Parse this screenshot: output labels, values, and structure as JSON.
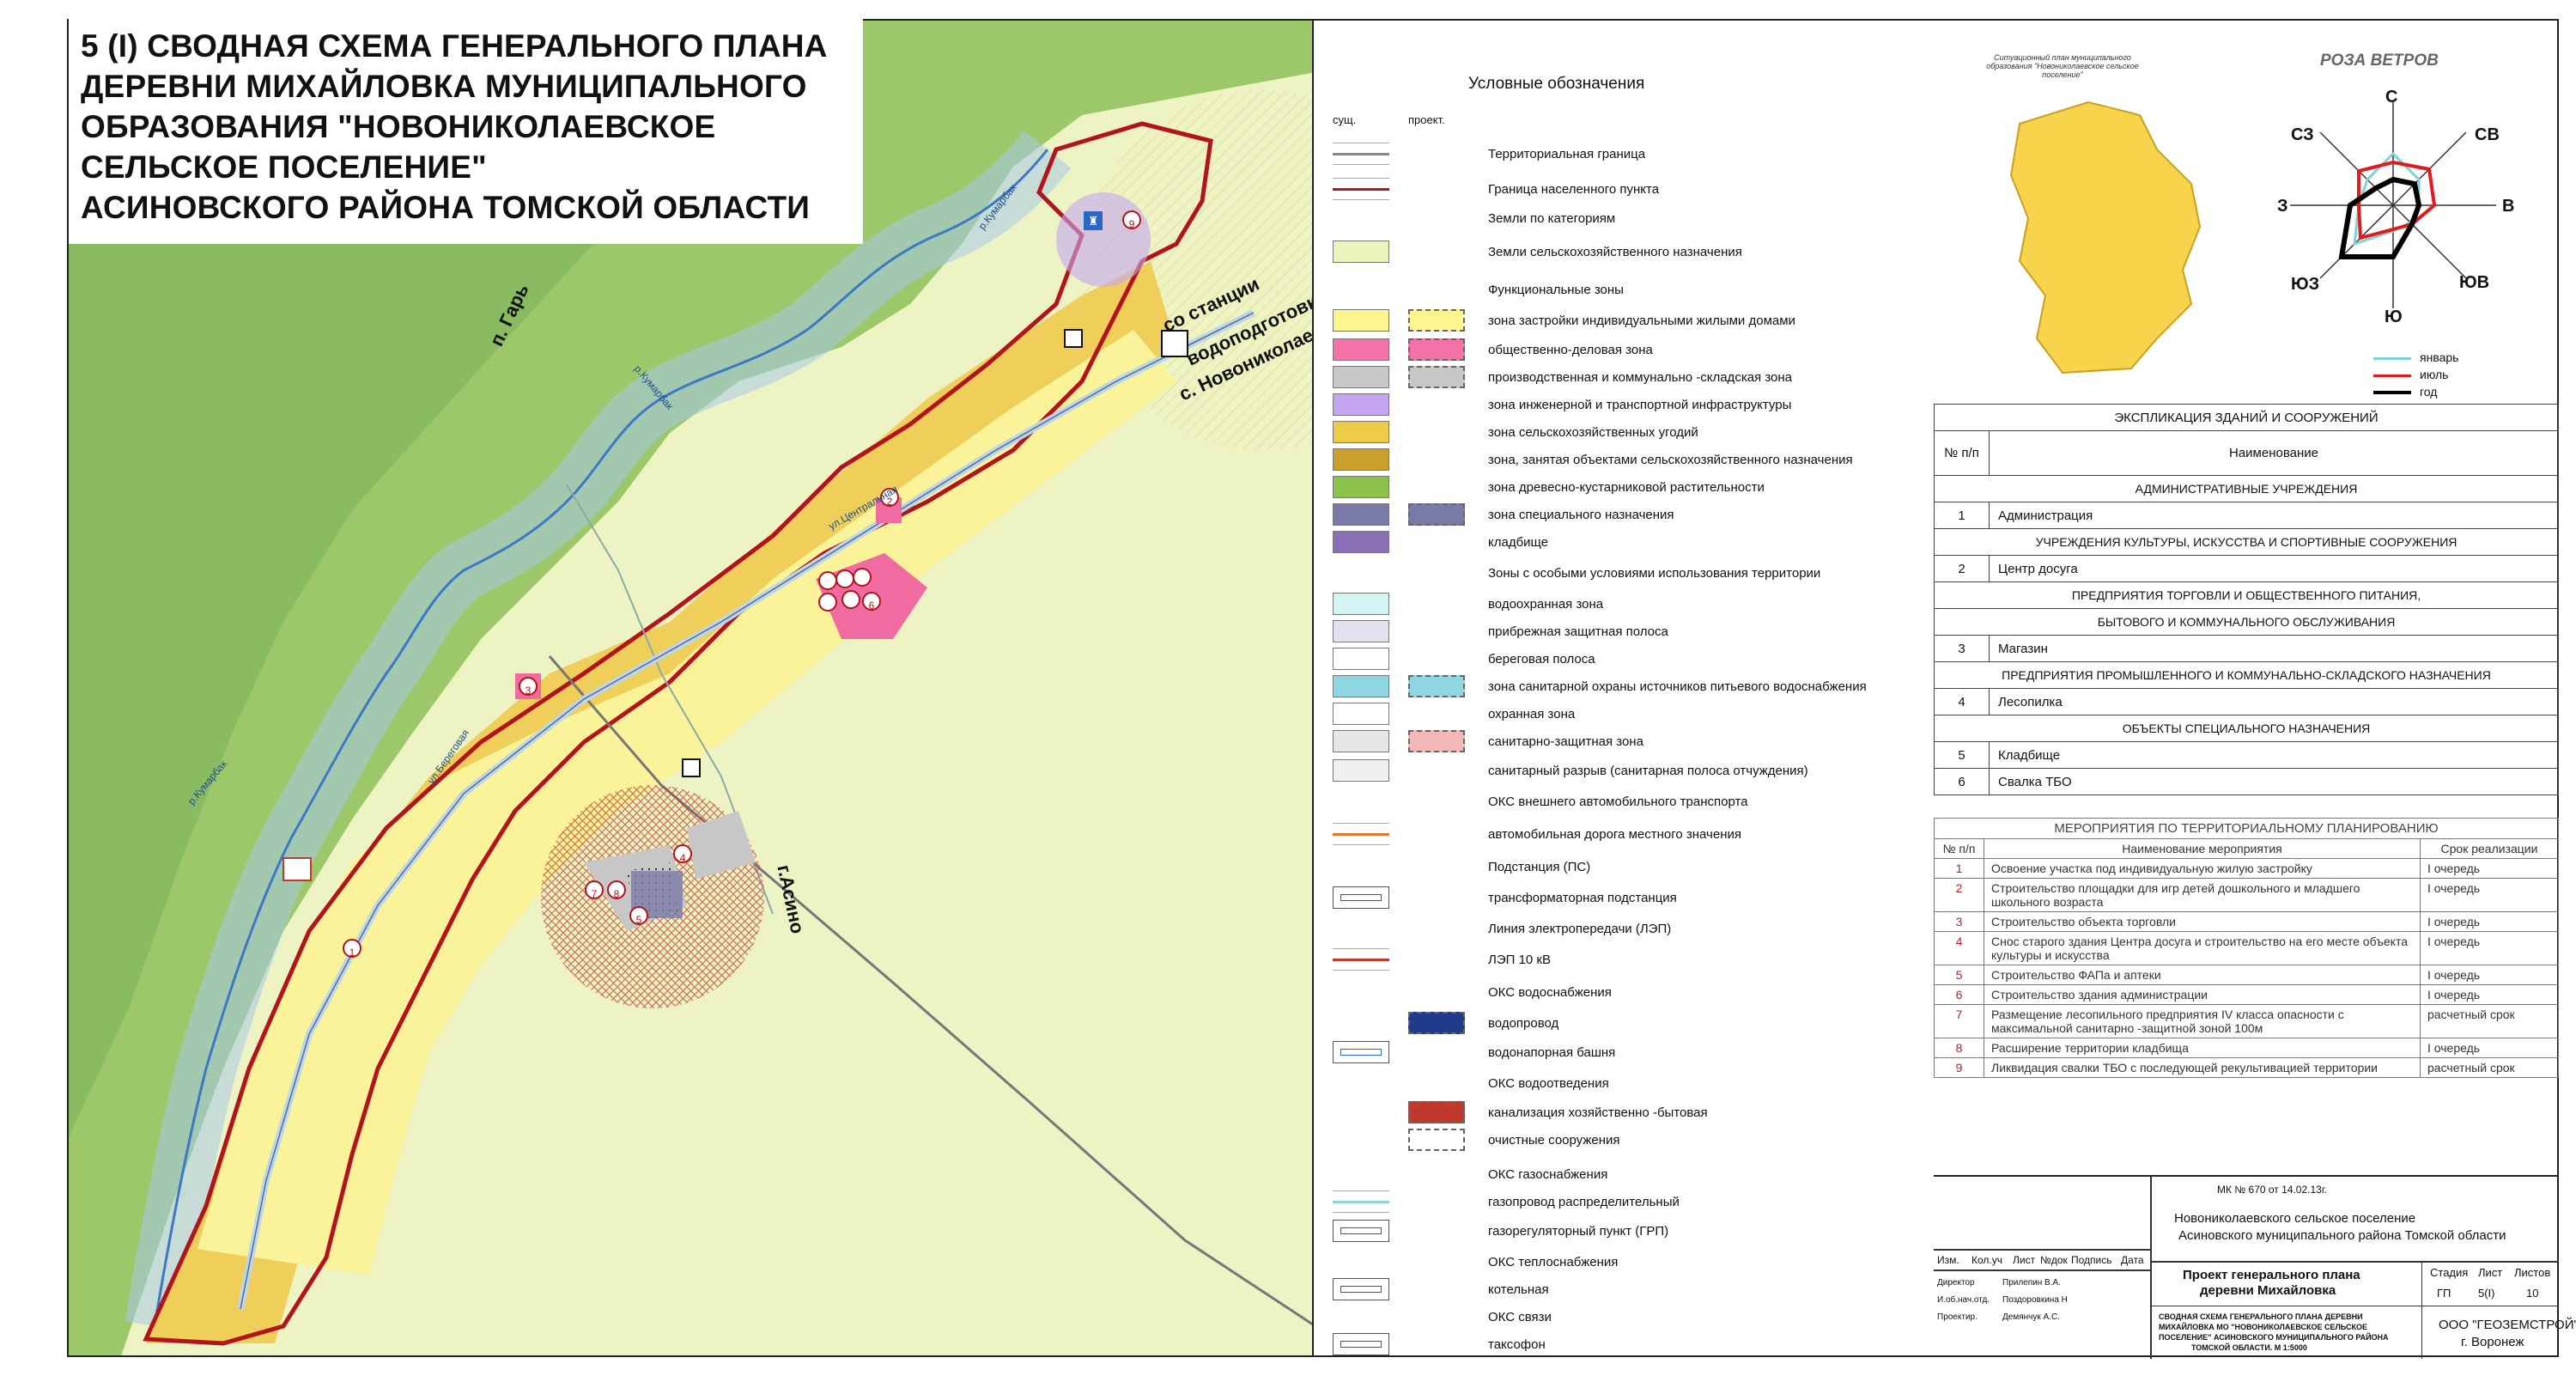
{
  "map": {
    "title_lines": [
      "5 (I) СВОДНАЯ СХЕМА ГЕНЕРАЛЬНОГО ПЛАНА",
      "ДЕРЕВНИ МИХАЙЛОВКА МУНИЦИПАЛЬНОГО",
      "ОБРАЗОВАНИЯ \"НОВОНИКОЛАЕВСКОЕ",
      "СЕЛЬСКОЕ ПОСЕЛЕНИЕ\"",
      "АСИНОВСКОГО РАЙОНА ТОМСКОЙ ОБЛАСТИ"
    ],
    "labels": {
      "river_1": "р.Кумарбак",
      "river_2": "р.Кумарбак",
      "river_3": "р.Кумарбак",
      "street_1": "ул.Береговая",
      "street_2": "ул.Центральная",
      "road_gar": "п. Гарь",
      "road_station_1": "со станции",
      "road_station_2": "водоподготовки",
      "road_novonik": "с. Новониколаевка",
      "road_asino": "г.Асино"
    },
    "markers": [
      "1",
      "2",
      "3",
      "4",
      "5",
      "6",
      "7",
      "8",
      "9"
    ]
  },
  "legend": {
    "title": "Условные обозначения",
    "col_existing": "сущ.",
    "col_project": "проект.",
    "items": [
      {
        "label": "Территориальная граница"
      },
      {
        "label": "Граница населенного пункта"
      },
      {
        "label": "Земли по категориям"
      },
      {
        "label": "Земли сельскохозяйственного назначения"
      },
      {
        "label": "Функциональные зоны"
      },
      {
        "label": "зона застройки индивидуальными жилыми домами"
      },
      {
        "label": "общественно-деловая зона"
      },
      {
        "label": "производственная и коммунально -складская зона"
      },
      {
        "label": "зона инженерной и транспортной инфраструктуры"
      },
      {
        "label": "зона сельскохозяйственных угодий"
      },
      {
        "label": "зона, занятая объектами сельскохозяйственного назначения"
      },
      {
        "label": "зона древесно-кустарниковой растительности"
      },
      {
        "label": "зона специального назначения"
      },
      {
        "label": "кладбище"
      },
      {
        "label": "Зоны с особыми условиями использования территории"
      },
      {
        "label": "водоохранная зона"
      },
      {
        "label": "прибрежная защитная полоса"
      },
      {
        "label": "береговая полоса"
      },
      {
        "label": "зона санитарной охраны источников питьевого водоснабжения"
      },
      {
        "label": "охранная зона"
      },
      {
        "label": "санитарно-защитная зона"
      },
      {
        "label": "санитарный разрыв (санитарная полоса отчуждения)"
      },
      {
        "label": "ОКС внешнего автомобильного транспорта"
      },
      {
        "label": "автомобильная дорога местного значения"
      },
      {
        "label": "Подстанция (ПС)"
      },
      {
        "label": "трансформаторная подстанция"
      },
      {
        "label": "Линия электропередачи (ЛЭП)"
      },
      {
        "label": "ЛЭП 10 кВ"
      },
      {
        "label": "ОКС водоснабжения"
      },
      {
        "label": "водопровод"
      },
      {
        "label": "водонапорная башня"
      },
      {
        "label": "ОКС водоотведения"
      },
      {
        "label": "канализация хозяйственно -бытовая"
      },
      {
        "label": "очистные сооружения"
      },
      {
        "label": "ОКС газоснабжения"
      },
      {
        "label": "газопровод распределительный"
      },
      {
        "label": "газорегуляторный пункт (ГРП)"
      },
      {
        "label": "ОКС теплоснабжения"
      },
      {
        "label": "котельная"
      },
      {
        "label": "ОКС связи"
      },
      {
        "label": "таксофон"
      }
    ],
    "colors": {
      "residential": "#fef58f",
      "public": "#f472a6",
      "industrial": "#c7c7c7",
      "infrastructure": "#c4a6f0",
      "agri_lands": "#eecb47",
      "agri_objects": "#c9a02b",
      "forest": "#8bc34a",
      "special": "#7a7aa8",
      "boundary": "#b3141b"
    }
  },
  "situation": {
    "caption": "Ситуационный план муниципального образования \"Новониколаевское сельское поселение\""
  },
  "wind_rose": {
    "title": "РОЗА ВЕТРОВ",
    "directions": {
      "n": "С",
      "ne": "СВ",
      "e": "В",
      "se": "ЮВ",
      "s": "Ю",
      "sw": "ЮЗ",
      "w": "З",
      "nw": "СЗ"
    },
    "legend": [
      {
        "label": "январь",
        "color": "#7fd3d3"
      },
      {
        "label": "июль",
        "color": "#e11b1b"
      },
      {
        "label": "год",
        "color": "#000000"
      }
    ]
  },
  "explication": {
    "title": "ЭКСПЛИКАЦИЯ ЗДАНИЙ И СООРУЖЕНИЙ",
    "col_num": "№ п/п",
    "col_name": "Наименование",
    "rows": [
      {
        "section": "АДМИНИСТРАТИВНЫЕ УЧРЕЖДЕНИЯ"
      },
      {
        "num": "1",
        "name": "Администрация"
      },
      {
        "section": "УЧРЕЖДЕНИЯ КУЛЬТУРЫ, ИСКУССТВА И СПОРТИВНЫЕ СООРУЖЕНИЯ"
      },
      {
        "num": "2",
        "name": "Центр досуга"
      },
      {
        "section": "ПРЕДПРИЯТИЯ ТОРГОВЛИ И ОБЩЕСТВЕННОГО ПИТАНИЯ,"
      },
      {
        "section": "БЫТОВОГО И КОММУНАЛЬНОГО ОБСЛУЖИВАНИЯ"
      },
      {
        "num": "3",
        "name": "Магазин"
      },
      {
        "section": "ПРЕДПРИЯТИЯ ПРОМЫШЛЕННОГО И КОММУНАЛЬНО-СКЛАДСКОГО НАЗНАЧЕНИЯ"
      },
      {
        "num": "4",
        "name": "Лесопилка"
      },
      {
        "section": "ОБЪЕКТЫ СПЕЦИАЛЬНОГО НАЗНАЧЕНИЯ"
      },
      {
        "num": "5",
        "name": "Кладбище"
      },
      {
        "num": "6",
        "name": "Свалка ТБО"
      }
    ]
  },
  "measures": {
    "title": "МЕРОПРИЯТИЯ ПО ТЕРРИТОРИАЛЬНОМУ ПЛАНИРОВАНИЮ",
    "col_num": "№ п/п",
    "col_name": "Наименование мероприятия",
    "col_term": "Срок реализации",
    "rows": [
      {
        "num": "1",
        "name": "Освоение участка под индивидуальную жилую застройку",
        "term": "I очередь"
      },
      {
        "num": "2",
        "name": "Строительство площадки для игр детей дошкольного и младшего школьного возраста",
        "term": "I очередь"
      },
      {
        "num": "3",
        "name": "Строительство объекта торговли",
        "term": "I очередь"
      },
      {
        "num": "4",
        "name": "Снос старого здания Центра досуга и строительство на его месте объекта культуры и искусства",
        "term": "I очередь"
      },
      {
        "num": "5",
        "name": "Строительство ФАПа и аптеки",
        "term": "I очередь"
      },
      {
        "num": "6",
        "name": "Строительство здания администрации",
        "term": "I очередь"
      },
      {
        "num": "7",
        "name": "Размещение лесопильного предприятия IV класса опасности с максимальной санитарно -защитной зоной 100м",
        "term": "расчетный срок"
      },
      {
        "num": "8",
        "name": "Расширение территории кладбища",
        "term": "I очередь"
      },
      {
        "num": "9",
        "name": "Ликвидация свалки ТБО с последующей рекультивацией территории",
        "term": "расчетный срок"
      }
    ]
  },
  "stamp": {
    "contract": "МК № 670 от 14.02.13г.",
    "org_line_1": "Новониколаевского сельское поселение",
    "org_line_2": "Асиновского муниципального района Томской области",
    "project_1": "Проект генерального плана",
    "project_2": "деревни Михайловка",
    "col_izm": "Изм.",
    "col_koluch": "Кол.уч",
    "col_list": "Лист",
    "col_ndok": "№док",
    "col_podpis": "Подпись",
    "col_data": "Дата",
    "col_stadiya": "Стадия",
    "col_list2": "Лист",
    "col_listov": "Листов",
    "stadiya": "ГП",
    "list": "5(I)",
    "listov": "10",
    "role_1": "Директор",
    "name_1": "Прилепин В.А.",
    "role_2": "И.об.нач.отд.",
    "name_2": "Поздоровкина Н",
    "role_3": "Проектир.",
    "name_3": "Демянчук А.С.",
    "sheet_title_1": "СВОДНАЯ СХЕМА ГЕНЕРАЛЬНОГО ПЛАНА ДЕРЕВНИ",
    "sheet_title_2": "МИХАЙЛОВКА МО \"НОВОНИКОЛАЕВСКОЕ СЕЛЬСКОЕ",
    "sheet_title_3": "ПОСЕЛЕНИЕ\" АСИНОВСКОГО МУНИЦИПАЛЬНОГО РАЙОНА",
    "sheet_title_4": "ТОМСКОЙ ОБЛАСТИ. М 1:5000",
    "company": "ООО \"ГЕОЗЕМСТРОЙ\"",
    "city": "г. Воронеж"
  }
}
